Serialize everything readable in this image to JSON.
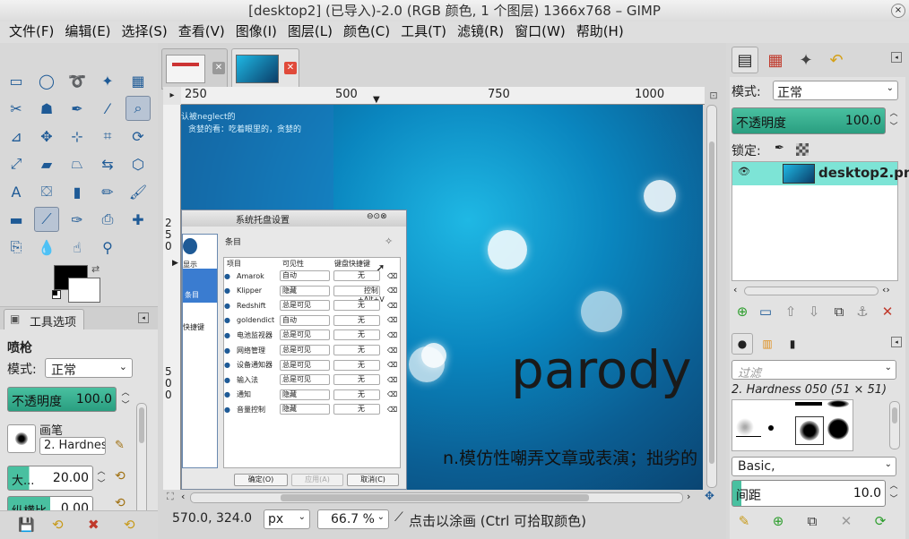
{
  "window": {
    "title": "[desktop2] (已导入)-2.0 (RGB 颜色, 1 个图层) 1366x768 – GIMP",
    "close": "⨯"
  },
  "menu": [
    "文件(F)",
    "编辑(E)",
    "选择(S)",
    "查看(V)",
    "图像(I)",
    "图层(L)",
    "颜色(C)",
    "工具(T)",
    "滤镜(R)",
    "窗口(W)",
    "帮助(H)"
  ],
  "toolbox": {
    "tools": [
      {
        "name": "rect-select-icon",
        "glyph": "▭"
      },
      {
        "name": "ellipse-select-icon",
        "glyph": "◯"
      },
      {
        "name": "free-select-icon",
        "glyph": "➰"
      },
      {
        "name": "fuzzy-select-icon",
        "glyph": "✦"
      },
      {
        "name": "color-select-icon",
        "glyph": "▦"
      },
      {
        "name": "scissors-icon",
        "glyph": "✂"
      },
      {
        "name": "foreground-select-icon",
        "glyph": "☗"
      },
      {
        "name": "paths-icon",
        "glyph": "✒"
      },
      {
        "name": "color-picker-icon",
        "glyph": "⁄"
      },
      {
        "name": "zoom-icon",
        "glyph": "⌕"
      },
      {
        "name": "measure-icon",
        "glyph": "⊿"
      },
      {
        "name": "move-icon",
        "glyph": "✥"
      },
      {
        "name": "align-icon",
        "glyph": "⊹"
      },
      {
        "name": "crop-icon",
        "glyph": "⌗"
      },
      {
        "name": "rotate-icon",
        "glyph": "⟳"
      },
      {
        "name": "scale-icon",
        "glyph": "⤢"
      },
      {
        "name": "shear-icon",
        "glyph": "▰"
      },
      {
        "name": "perspective-icon",
        "glyph": "⏢"
      },
      {
        "name": "flip-icon",
        "glyph": "⇆"
      },
      {
        "name": "cage-icon",
        "glyph": "⬡"
      },
      {
        "name": "text-icon",
        "glyph": "A"
      },
      {
        "name": "bucket-fill-icon",
        "glyph": "⛋"
      },
      {
        "name": "blend-icon",
        "glyph": "▮"
      },
      {
        "name": "pencil-icon",
        "glyph": "✏"
      },
      {
        "name": "paintbrush-icon",
        "glyph": "🖌"
      },
      {
        "name": "eraser-icon",
        "glyph": "▬"
      },
      {
        "name": "airbrush-icon",
        "glyph": "⟋"
      },
      {
        "name": "ink-icon",
        "glyph": "✑"
      },
      {
        "name": "clone-icon",
        "glyph": "⎙"
      },
      {
        "name": "heal-icon",
        "glyph": "✚"
      },
      {
        "name": "perspective-clone-icon",
        "glyph": "⎘"
      },
      {
        "name": "blur-icon",
        "glyph": "💧"
      },
      {
        "name": "smudge-icon",
        "glyph": "☝"
      },
      {
        "name": "dodge-burn-icon",
        "glyph": "⚲"
      }
    ],
    "tool_options_tab": "工具选项",
    "tool_name": "喷枪",
    "mode_label": "模式:",
    "mode_value": "正常",
    "opacity_label": "不透明度",
    "opacity_value": "100.0",
    "opacity": 1.0,
    "brush_label": "画笔",
    "brush_value": "2. Hardnes",
    "size_label": "大...",
    "size_value": "20.00",
    "aspect_label": "纵横比",
    "aspect_value": "0.00"
  },
  "image_tabs": [
    {
      "name": "image-tab-1"
    },
    {
      "name": "image-tab-desktop2"
    }
  ],
  "ruler": {
    "h_ticks": [
      "250",
      "500",
      "750",
      "1000"
    ],
    "v_ticks": [
      "2",
      "5",
      "0",
      "5",
      "0",
      "0"
    ]
  },
  "canvas": {
    "text_top1": "认被neglect的",
    "text_top2": "贪婪的看：吃着眼里的，贪婪的",
    "big_word": "parody",
    "definition": "n.模仿性嘲弄文章或表演；拙劣的"
  },
  "dialog": {
    "title": "系统托盘设置",
    "section": "条目",
    "side_items": [
      "显示",
      "条目",
      "快捷键"
    ],
    "headers": [
      "项目",
      "可见性",
      "键盘快捷键"
    ],
    "rows": [
      {
        "name": "Amarok",
        "vis": "自动",
        "key": "无"
      },
      {
        "name": "Klipper",
        "vis": "隐藏",
        "key": "控制+Alt+V"
      },
      {
        "name": "Redshift",
        "vis": "总是可见",
        "key": "无"
      },
      {
        "name": "goldendict",
        "vis": "自动",
        "key": "无"
      },
      {
        "name": "电池监视器",
        "vis": "总是可见",
        "key": "无"
      },
      {
        "name": "网络管理",
        "vis": "总是可见",
        "key": "无"
      },
      {
        "name": "设备通知器",
        "vis": "总是可见",
        "key": "无"
      },
      {
        "name": "输入法",
        "vis": "总是可见",
        "key": "无"
      },
      {
        "name": "通知",
        "vis": "隐藏",
        "key": "无"
      },
      {
        "name": "音量控制",
        "vis": "隐藏",
        "key": "无"
      }
    ],
    "ok": "确定(O)",
    "apply": "应用(A)",
    "cancel": "取消(C)"
  },
  "status": {
    "coords": "570.0, 324.0",
    "unit": "px",
    "zoom": "66.7 %",
    "hint": "点击以涂画 (Ctrl 可拾取颜色)"
  },
  "layers": {
    "mode_label": "模式:",
    "mode_value": "正常",
    "opacity_label": "不透明度",
    "opacity_value": "100.0",
    "opacity": 1.0,
    "lock_label": "锁定:",
    "layer_name": "desktop2.pn"
  },
  "brushes": {
    "filter_placeholder": "过滤",
    "brush_name": "2. Hardness 050 (51 × 51)",
    "preset": "Basic,",
    "spacing_label": "间距",
    "spacing_value": "10.0"
  },
  "colors": {
    "accent_green": "#2a9e80",
    "canvas_blue": "#0a86bf",
    "close_red": "#e04a3a"
  }
}
